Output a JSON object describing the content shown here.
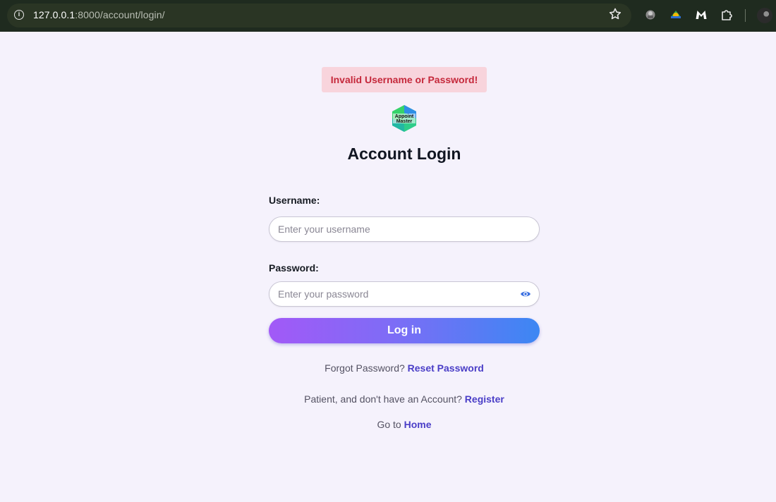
{
  "browser": {
    "url_host": "127.0.0.1",
    "url_rest": ":8000/account/login/",
    "info_icon": "info-icon",
    "star_icon": "star-icon",
    "extensions": [
      "ext-icon-1",
      "ext-icon-2",
      "malwarebytes-icon",
      "puzzle-icon"
    ],
    "profile_icon": "avatar"
  },
  "alert": {
    "text": "Invalid Username or Password!"
  },
  "logo": {
    "line1": "Appoint",
    "line2": "Master"
  },
  "form": {
    "title": "Account Login",
    "username_label": "Username:",
    "username_placeholder": "Enter your username",
    "username_value": "",
    "password_label": "Password:",
    "password_placeholder": "Enter your password",
    "password_value": "",
    "submit_label": "Log in"
  },
  "links": {
    "forgot_text": "Forgot Password?",
    "forgot_link": "Reset Password",
    "register_text": "Patient, and don't have an Account?",
    "register_link": "Register",
    "home_text": "Go to",
    "home_link": "Home"
  },
  "colors": {
    "page_bg": "#f5f2fc",
    "alert_bg": "#f8d4dc",
    "alert_text": "#c5283b",
    "link": "#4a3ec7",
    "button_gradient_start": "#a259f7",
    "button_gradient_end": "#3c87f3"
  }
}
